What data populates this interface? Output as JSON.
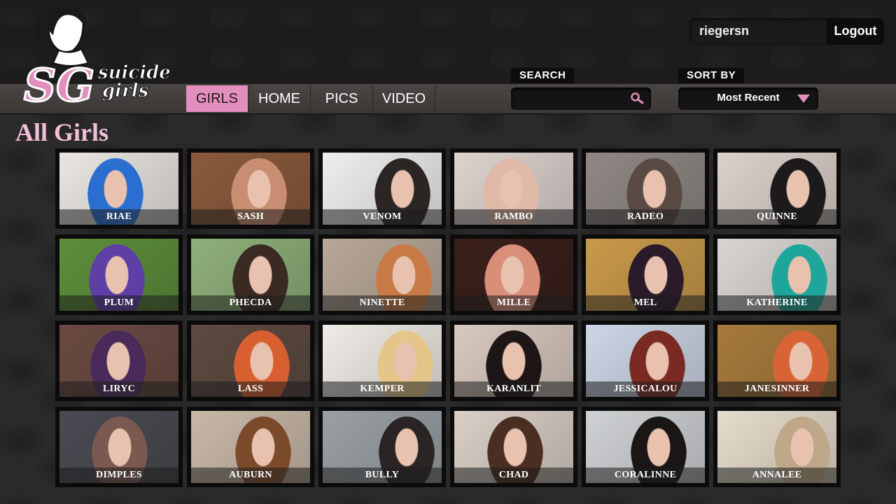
{
  "header": {
    "logo_text": "SG suicide girls",
    "username": "riegersn",
    "logout_label": "Logout"
  },
  "nav": {
    "tabs": [
      {
        "label": "GIRLS",
        "active": true
      },
      {
        "label": "HOME",
        "active": false
      },
      {
        "label": "PICS",
        "active": false
      },
      {
        "label": "VIDEO",
        "active": false
      }
    ]
  },
  "search": {
    "label": "SEARCH",
    "value": "",
    "icon": "magnifier-icon"
  },
  "sort": {
    "label": "SORT BY",
    "value": "Most Recent",
    "icon": "triangle-down-icon"
  },
  "page": {
    "title": "All Girls"
  },
  "colors": {
    "accent": "#e38fbd",
    "title": "#f3bfd6",
    "background": "#2b2a2a"
  },
  "girls": [
    {
      "name": "RIAE",
      "bg": "#e9e6e2",
      "fig": "#2a6fd0"
    },
    {
      "name": "SASH",
      "bg": "#8a5a3c",
      "fig": "#c98e72"
    },
    {
      "name": "VENOM",
      "bg": "#eeeeee",
      "fig": "#2b2624"
    },
    {
      "name": "RAMBO",
      "bg": "#ddd3cf",
      "fig": "#e0b9a8"
    },
    {
      "name": "RADEO",
      "bg": "#8f8884",
      "fig": "#5a4a44"
    },
    {
      "name": "QUINNE",
      "bg": "#dcd2cc",
      "fig": "#1c1a1a"
    },
    {
      "name": "PLUM",
      "bg": "#5c8f3a",
      "fig": "#5e3fa5"
    },
    {
      "name": "PHECDA",
      "bg": "#8fb07a",
      "fig": "#3a2a22"
    },
    {
      "name": "NINETTE",
      "bg": "#b8a898",
      "fig": "#c77a45"
    },
    {
      "name": "MILLE",
      "bg": "#3a1f1a",
      "fig": "#d98e78"
    },
    {
      "name": "MEL",
      "bg": "#c99a4a",
      "fig": "#2a1a2a"
    },
    {
      "name": "KATHERINE",
      "bg": "#d9d6d2",
      "fig": "#1fa69a"
    },
    {
      "name": "LIRYC",
      "bg": "#6a4a42",
      "fig": "#4a2a5a"
    },
    {
      "name": "LASS",
      "bg": "#5e4a40",
      "fig": "#d86030"
    },
    {
      "name": "KEMPER",
      "bg": "#efebe6",
      "fig": "#e4c68a"
    },
    {
      "name": "KARANLIT",
      "bg": "#d8c9bf",
      "fig": "#1e1616"
    },
    {
      "name": "JESSICALOU",
      "bg": "#cdd6e6",
      "fig": "#7a2a22"
    },
    {
      "name": "JANESINNER",
      "bg": "#a77a3c",
      "fig": "#d86436"
    },
    {
      "name": "DIMPLES",
      "bg": "#4a4a52",
      "fig": "#7a5a50"
    },
    {
      "name": "AUBURN",
      "bg": "#c9b8a8",
      "fig": "#7a4a2a"
    },
    {
      "name": "BULLY",
      "bg": "#9aa0a4",
      "fig": "#2a2424"
    },
    {
      "name": "CHAD",
      "bg": "#d9cfc6",
      "fig": "#4a2e22"
    },
    {
      "name": "CORALINNE",
      "bg": "#cfd2d4",
      "fig": "#1a1616"
    },
    {
      "name": "ANNALEE",
      "bg": "#e6dccc",
      "fig": "#bfa88a"
    }
  ]
}
